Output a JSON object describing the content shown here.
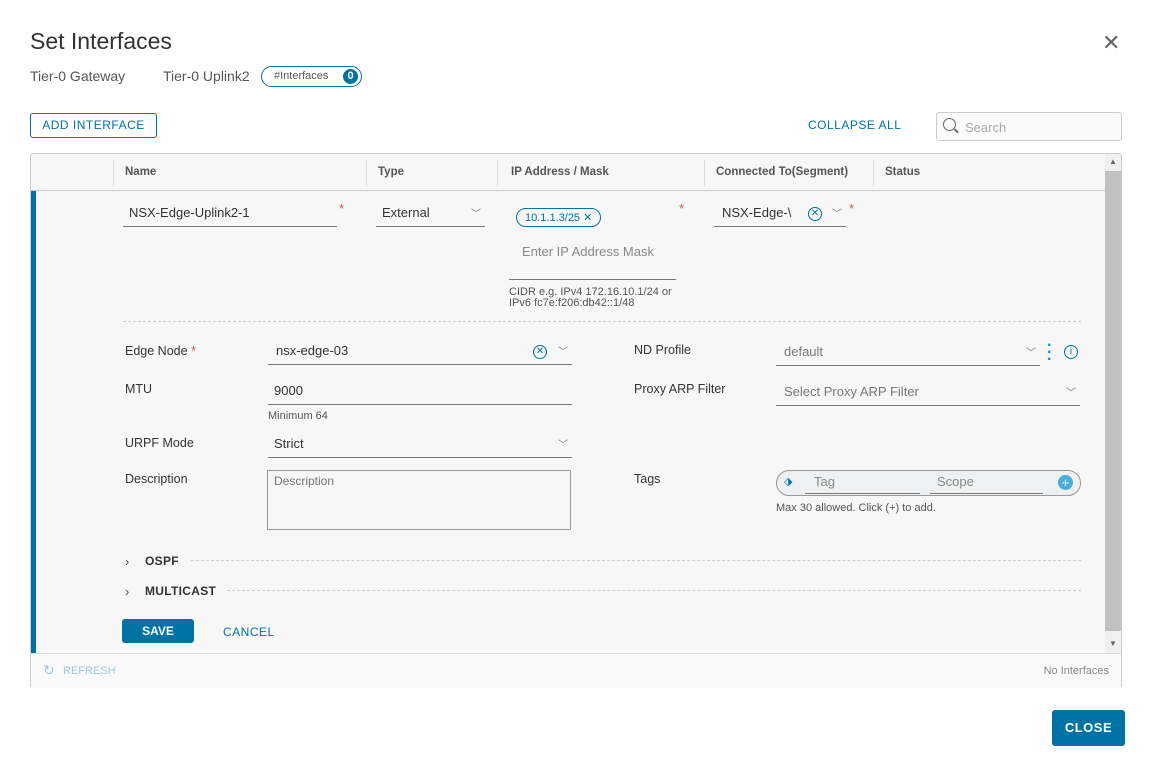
{
  "dialog": {
    "title": "Set Interfaces",
    "close_icon": "close-icon"
  },
  "breadcrumb": {
    "gateway": "Tier-0 Gateway",
    "uplink": "Tier-0 Uplink2",
    "badge_label": "#Interfaces",
    "badge_count": "0"
  },
  "toolbar": {
    "add_interface": "ADD INTERFACE",
    "collapse_all": "COLLAPSE ALL",
    "search_placeholder": "Search"
  },
  "table": {
    "columns": [
      "Name",
      "Type",
      "IP Address / Mask",
      "Connected To(Segment)",
      "Status"
    ]
  },
  "row": {
    "name": "NSX-Edge-Uplink2-1",
    "type": "External",
    "ip_tag": "10.1.1.3/25",
    "ip_placeholder": "Enter IP Address Mask",
    "ip_hint_1": "CIDR e.g. IPv4 172.16.10.1/24 or",
    "ip_hint_2": "IPv6 fc7e:f206:db42::1/48",
    "segment": "NSX-Edge-\\"
  },
  "form": {
    "edge_node_label": "Edge Node",
    "edge_node": "nsx-edge-03",
    "mtu_label": "MTU",
    "mtu": "9000",
    "mtu_hint": "Minimum 64",
    "urpf_label": "URPF Mode",
    "urpf": "Strict",
    "description_label": "Description",
    "description_placeholder": "Description",
    "nd_profile_label": "ND Profile",
    "nd_profile": "default",
    "proxy_arp_label": "Proxy ARP Filter",
    "proxy_arp_placeholder": "Select Proxy ARP Filter",
    "tags_label": "Tags",
    "tag_placeholder": "Tag",
    "scope_placeholder": "Scope",
    "tags_hint": "Max 30 allowed. Click (+) to add.",
    "ospf": "OSPF",
    "multicast": "MULTICAST",
    "save": "SAVE",
    "cancel": "CANCEL"
  },
  "footer": {
    "refresh": "REFRESH",
    "count": "No Interfaces"
  },
  "actions": {
    "close": "CLOSE"
  },
  "colors": {
    "accent": "#0072a3",
    "required": "#d9534f"
  }
}
